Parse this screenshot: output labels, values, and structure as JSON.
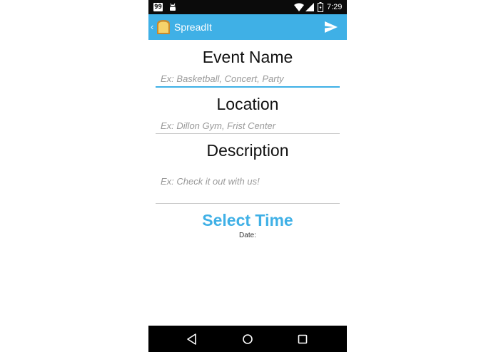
{
  "status_bar": {
    "badge": "99",
    "time": "7:29",
    "icons": [
      "badge-icon",
      "android-icon",
      "wifi-icon",
      "signal-icon",
      "battery-icon"
    ]
  },
  "app_bar": {
    "title": "SpreadIt",
    "up_icon": "up-caret-icon",
    "app_icon": "toast-icon",
    "action_icon": "send-icon",
    "color": "#3fb0e6"
  },
  "form": {
    "event_name": {
      "label": "Event Name",
      "placeholder": "Ex: Basketball, Concert, Party",
      "value": ""
    },
    "location": {
      "label": "Location",
      "placeholder": "Ex: Dillon Gym, Frist Center",
      "value": ""
    },
    "description": {
      "label": "Description",
      "placeholder": "Ex: Check it out with us!",
      "value": ""
    },
    "select_time_label": "Select Time",
    "date_label": "Date:"
  },
  "nav_bar": {
    "icons": [
      "back-triangle-icon",
      "home-circle-icon",
      "recents-square-icon"
    ]
  }
}
